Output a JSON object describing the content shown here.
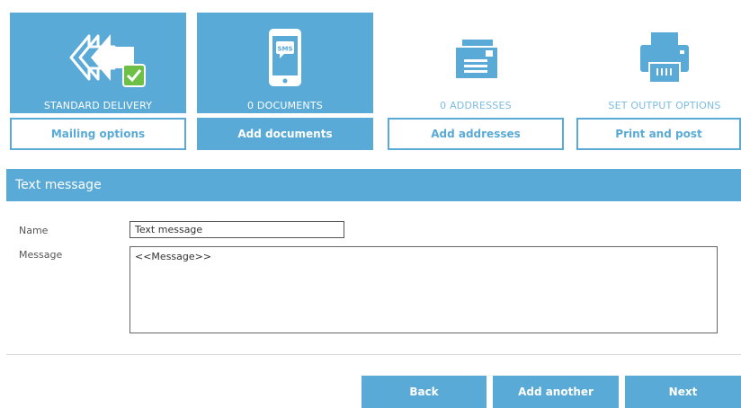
{
  "steps": [
    {
      "caption": "STANDARD DELIVERY",
      "button": "Mailing options",
      "icon": "delivery-arrows-check-icon",
      "active_tile": true,
      "active_button": false
    },
    {
      "caption": "0 DOCUMENTS",
      "button": "Add documents",
      "icon": "sms-phone-icon",
      "active_tile": true,
      "active_button": true
    },
    {
      "caption": "0 ADDRESSES",
      "button": "Add addresses",
      "icon": "envelopes-icon",
      "active_tile": false,
      "active_button": false
    },
    {
      "caption": "SET OUTPUT OPTIONS",
      "button": "Print and post",
      "icon": "printer-icon",
      "active_tile": false,
      "active_button": false
    }
  ],
  "sms_icon_text": "SMS",
  "panel": {
    "title": "Text message",
    "name_label": "Name",
    "name_value": "Text message",
    "message_label": "Message",
    "message_value": "<<Message>>"
  },
  "actions": {
    "back": "Back",
    "add_another": "Add another",
    "next": "Next"
  },
  "colors": {
    "accent": "#5aaad7",
    "check_green": "#6dbf45"
  }
}
